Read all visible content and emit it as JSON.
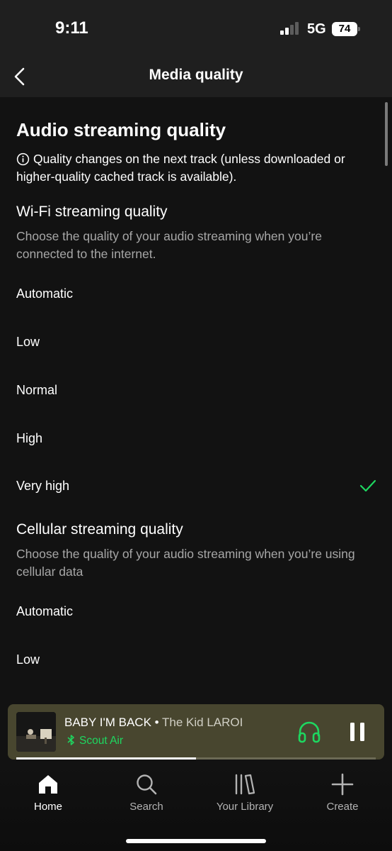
{
  "status": {
    "time": "9:11",
    "network": "5G",
    "battery": "74"
  },
  "header": {
    "title": "Media quality"
  },
  "audio": {
    "title": "Audio streaming quality",
    "info_line1": "Quality changes on the next track (unless downloaded or",
    "info_line2": "higher-quality cached track is available)."
  },
  "wifi": {
    "title": "Wi-Fi streaming quality",
    "description": "Choose the quality of your audio streaming when you’re connected to the internet.",
    "options": [
      "Automatic",
      "Low",
      "Normal",
      "High",
      "Very high"
    ],
    "selected": "Very high"
  },
  "cellular": {
    "title": "Cellular streaming quality",
    "description": "Choose the quality of your audio streaming when you’re using cellular data",
    "options": [
      "Automatic",
      "Low"
    ]
  },
  "player": {
    "track": "BABY I'M BACK",
    "separator": " • ",
    "artist": "The Kid LAROI",
    "device": "Scout Air",
    "progress": 0.5
  },
  "nav": {
    "items": [
      {
        "label": "Home",
        "icon": "home-icon"
      },
      {
        "label": "Search",
        "icon": "search-icon"
      },
      {
        "label": "Your Library",
        "icon": "library-icon"
      },
      {
        "label": "Create",
        "icon": "plus-icon"
      }
    ],
    "active": "Home"
  },
  "colors": {
    "accent": "#1ed760",
    "background": "#121212",
    "header": "#1f1f1f",
    "player": "#48462f"
  }
}
